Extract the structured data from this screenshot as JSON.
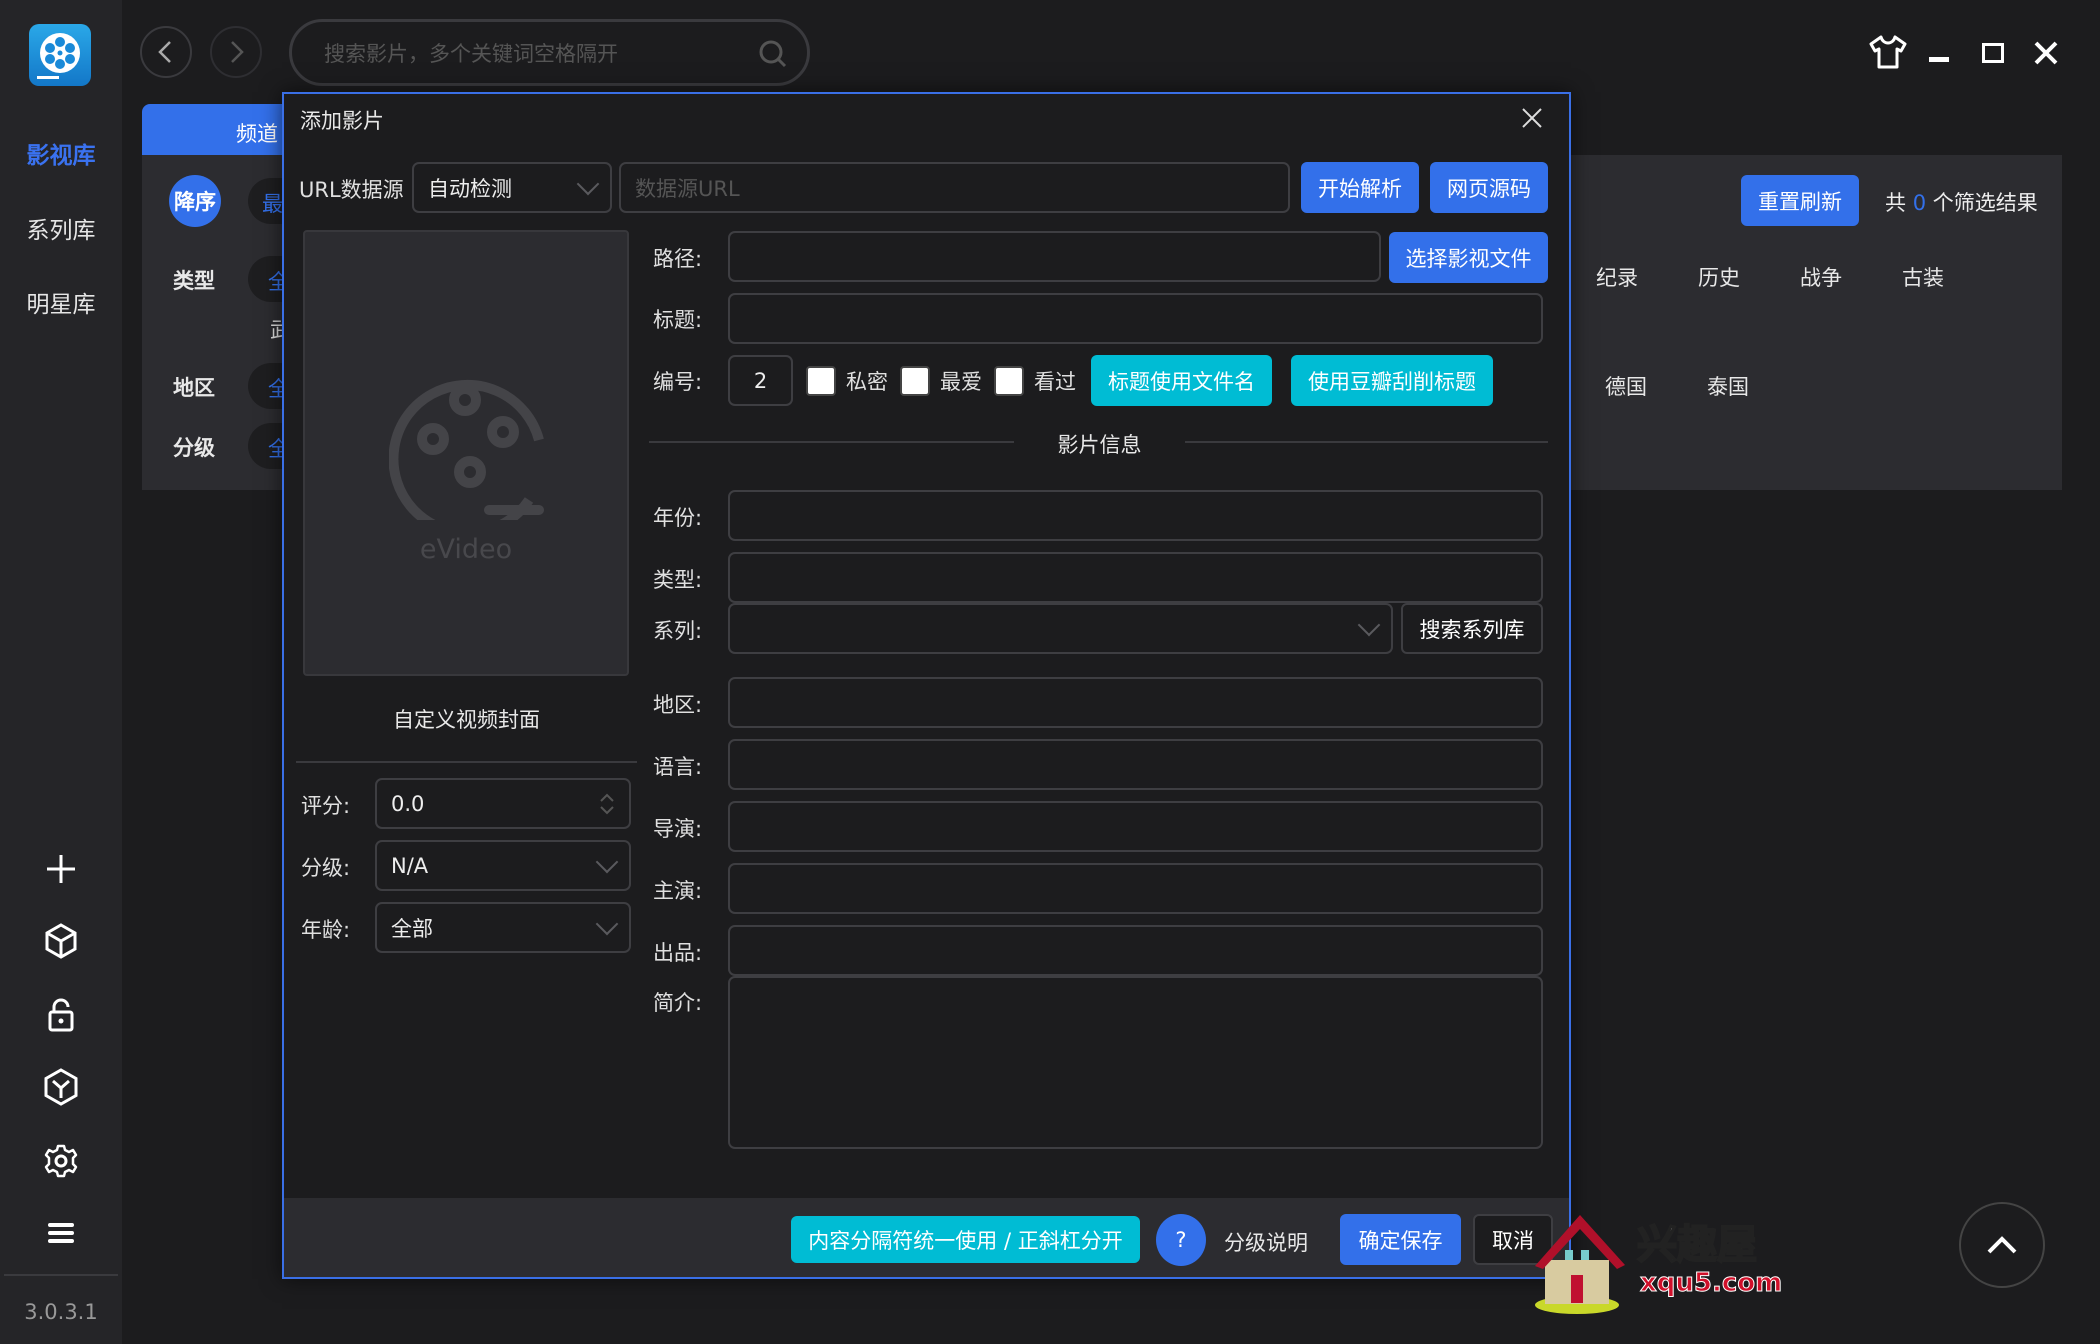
{
  "app": {
    "version": "3.0.3.1",
    "accent": "#3370ea",
    "teal": "#00bcd4"
  },
  "sidebar": {
    "items": [
      {
        "label": "影视库",
        "active": true
      },
      {
        "label": "系列库"
      },
      {
        "label": "明星库"
      }
    ],
    "tools": [
      "plus-icon",
      "cube-icon",
      "lock-icon",
      "box-icon",
      "gear-icon",
      "menu-icon"
    ]
  },
  "topbar": {
    "search_placeholder": "搜索影片，多个关键词空格隔开"
  },
  "main": {
    "tab_label": "频道",
    "sort_label": "降序",
    "sort_partial": "最",
    "filters": [
      {
        "label": "类型"
      },
      {
        "label": "地区"
      },
      {
        "label": "分级"
      }
    ],
    "partial_all": "全",
    "partial_extra": "武",
    "reset_label": "重置刷新",
    "result_prefix": "共",
    "result_count": "0",
    "result_suffix": "个筛选结果",
    "genres": [
      "纪录",
      "历史",
      "战争",
      "古装"
    ],
    "regions": [
      "德国",
      "泰国"
    ]
  },
  "dialog": {
    "title": "添加影片",
    "url_label": "URL数据源",
    "url_source": "自动检测",
    "url_placeholder": "数据源URL",
    "parse_label": "开始解析",
    "source_label": "网页源码",
    "cover_brand": "eVideo",
    "cover_label": "自定义视频封面",
    "score_label": "评分:",
    "score_value": "0.0",
    "rating_label": "分级:",
    "rating_value": "N/A",
    "age_label": "年龄:",
    "age_value": "全部",
    "path_label": "路径:",
    "choose_file_label": "选择影视文件",
    "title_label": "标题:",
    "number_label": "编号:",
    "number_value": "2",
    "checks": [
      {
        "label": "私密",
        "checked": false
      },
      {
        "label": "最爱",
        "checked": false
      },
      {
        "label": "看过",
        "checked": false
      }
    ],
    "use_filename_label": "标题使用文件名",
    "use_douban_label": "使用豆瓣刮削标题",
    "section_label": "影片信息",
    "series_label": "系列:",
    "search_series_label": "搜索系列库",
    "fields": [
      {
        "label": "年份:"
      },
      {
        "label": "类型:"
      },
      {
        "label": "地区:"
      },
      {
        "label": "语言:"
      },
      {
        "label": "导演:"
      },
      {
        "label": "主演:"
      },
      {
        "label": "出品:"
      }
    ],
    "intro_label": "简介:",
    "footer": {
      "separator_label": "内容分隔符统一使用 / 正斜杠分开",
      "help_label": "?",
      "rating_help_label": "分级说明",
      "save_label": "确定保存",
      "cancel_label": "取消"
    }
  },
  "watermark": {
    "name": "兴趣屋",
    "url": "xqu5.com"
  }
}
